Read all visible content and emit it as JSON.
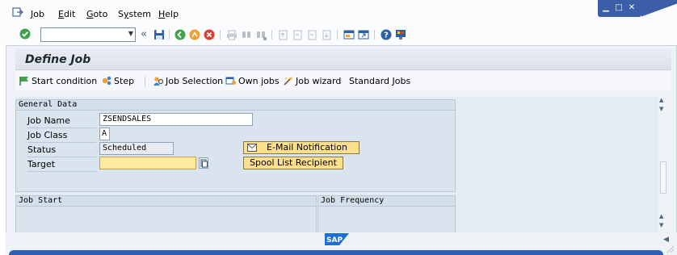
{
  "menu": {
    "items": [
      {
        "label": "Job",
        "underline": "J"
      },
      {
        "label": "Edit",
        "underline": "E"
      },
      {
        "label": "Goto",
        "underline": "G"
      },
      {
        "label": "System",
        "underline": "y"
      },
      {
        "label": "Help",
        "underline": "H"
      }
    ]
  },
  "toolbar": {
    "command_value": "",
    "nav_back_label": "«"
  },
  "page": {
    "title": "Define Job"
  },
  "app_toolbar": {
    "start_condition": "Start condition",
    "step": "Step",
    "job_selection": "Job Selection",
    "own_jobs": "Own jobs",
    "job_wizard": "Job wizard",
    "standard_jobs": "Standard Jobs"
  },
  "general_data": {
    "header": "General Data",
    "job_name_label": "Job Name",
    "job_name_value": "ZSENDSALES",
    "job_class_label": "Job Class",
    "job_class_value": "A",
    "status_label": "Status",
    "status_value": "Scheduled",
    "target_label": "Target",
    "target_value": "",
    "email_button": "E-Mail Notification",
    "spool_button": "Spool List Recipient"
  },
  "job_start": {
    "header": "Job Start"
  },
  "job_frequency": {
    "header": "Job Frequency"
  },
  "colors": {
    "accent": "#3c5ea6",
    "required_field": "#ffeaa0",
    "button_fill": "#fddf8e"
  }
}
